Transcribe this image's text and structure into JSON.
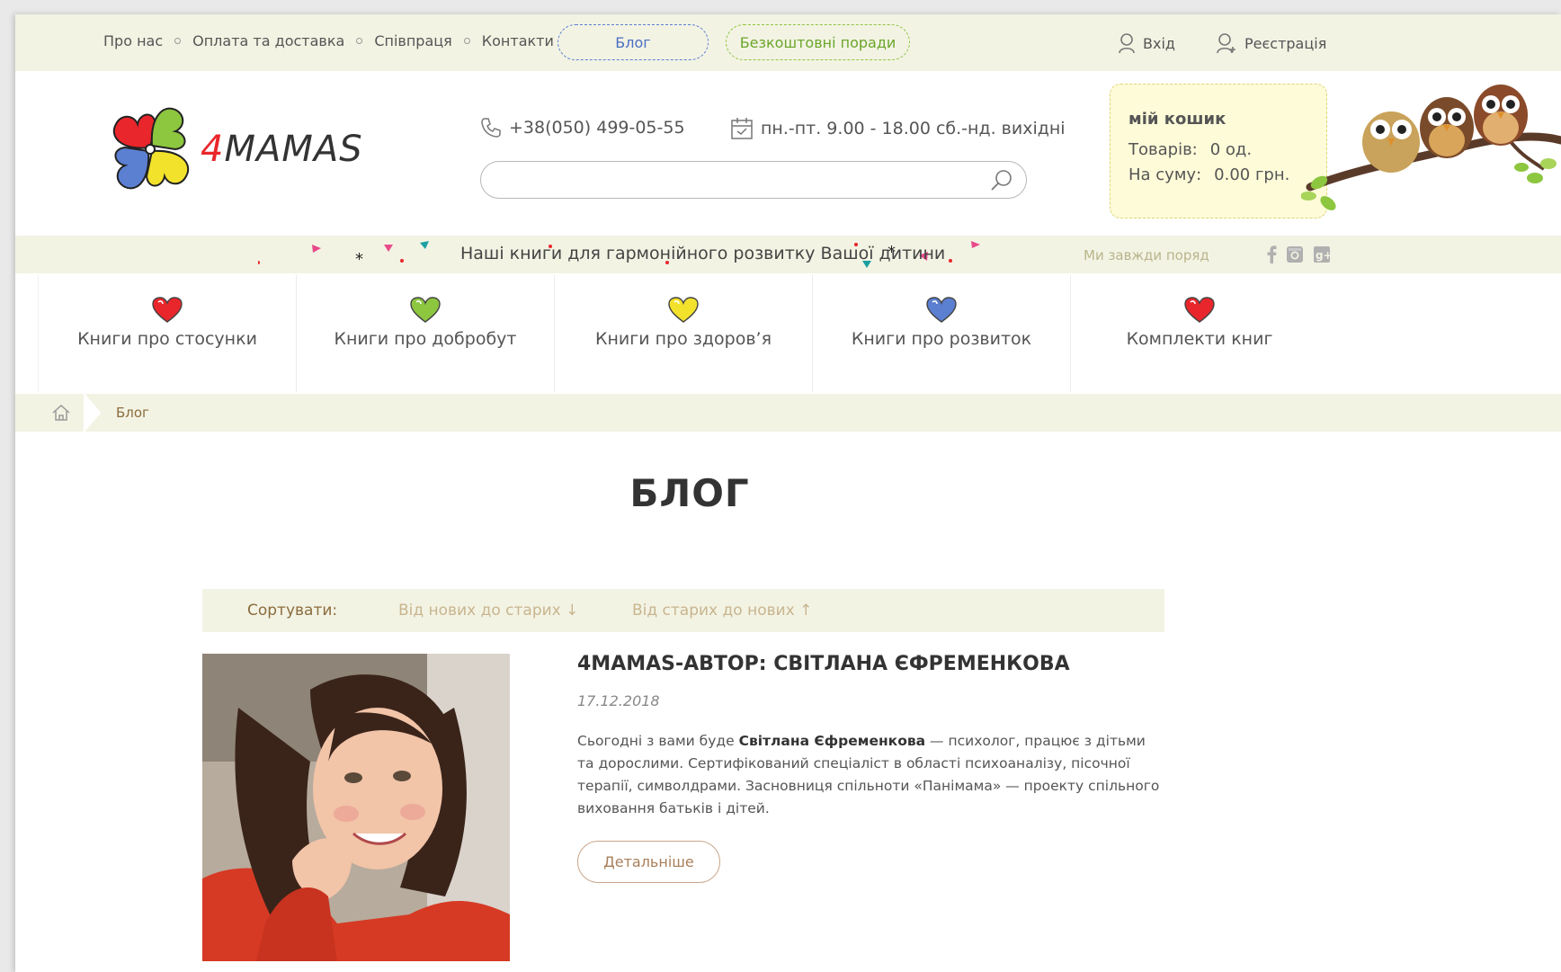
{
  "top_nav": {
    "items": [
      "Про нас",
      "Оплата та доставка",
      "Співпраця",
      "Контакти"
    ],
    "blog_button": "Блог",
    "tips_button": "Безкоштовні поради",
    "login": "Вхід",
    "register": "Реєстрація"
  },
  "header": {
    "logo_prefix": "4",
    "logo_text": "MAMAS",
    "phone": "+38(050) 499-05-55",
    "hours": "пн.-пт. 9.00 - 18.00 сб.-нд. вихідні",
    "search_placeholder": ""
  },
  "cart": {
    "title": "Мій кошик",
    "items_label": "Товарів:",
    "items_value": "0 од.",
    "sum_label": "На суму:",
    "sum_value": "0.00 грн."
  },
  "ribbon": {
    "text": "Наші книги для гармонійного розвитку Вашої дитини",
    "tagline": "Ми завжди поряд",
    "social": [
      "facebook-icon",
      "instagram-icon",
      "google-plus-icon"
    ]
  },
  "categories": [
    {
      "label": "Книги про стосунки",
      "color": "#e9262b"
    },
    {
      "label": "Книги про добробут",
      "color": "#8dc63f"
    },
    {
      "label": "Книги про здоров’я",
      "color": "#f2e22c"
    },
    {
      "label": "Книги про розвиток",
      "color": "#5b7fd1"
    },
    {
      "label": "Комплекти книг",
      "color": "#e9262b"
    }
  ],
  "breadcrumb": {
    "current": "Блог"
  },
  "page_title": "БЛОГ",
  "sort": {
    "label": "Сортувати:",
    "newest": "Від нових до старих ↓",
    "oldest": "Від старих до нових ↑"
  },
  "article": {
    "title": "4MAMAS-АВТОР: СВІТЛАНА ЄФРЕМЕНКОВА",
    "date": "17.12.2018",
    "body_before": "Сьогодні з вами буде ",
    "body_bold": "Світлана Єфременкова",
    "body_after": " — психолог, працює з дітьми та дорослими. Сертифікований спеціаліст в області психоаналізу, пісочної терапії, символдрами. Засновниця спільноти «Панімама» — проекту спільного виховання батьків і дітей.",
    "more_button": "Детальніше"
  },
  "colors": {
    "band": "#f3f3e4",
    "blog_accent": "#4a6fc2",
    "tips_accent": "#6aa62a",
    "cart_bg": "#fdfbd8",
    "brown": "#8a6c3c"
  }
}
